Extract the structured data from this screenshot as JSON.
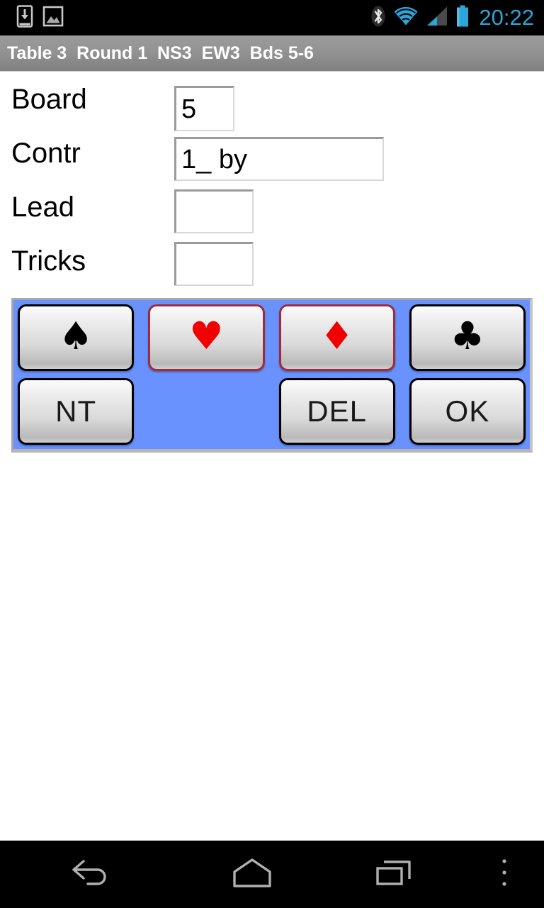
{
  "status_bar": {
    "icons_left": [
      "download-icon",
      "screenshot-image-icon"
    ],
    "icons_right": [
      "bluetooth-icon",
      "wifi-icon",
      "cellular-signal-icon",
      "battery-icon"
    ],
    "clock": "20:22",
    "clock_color": "#2ca5d8",
    "background_color": "#000000"
  },
  "title_bar": {
    "text": "Table 3  Round 1  NS3  EW3  Bds 5-6",
    "table": "Table 3",
    "round": "Round 1",
    "ns": "NS3",
    "ew": "EW3",
    "boards": "Bds 5-6",
    "background_color": "#8f8f8f",
    "text_color": "#ffffff"
  },
  "form": {
    "rows": [
      {
        "label": "Board",
        "value": "5",
        "placeholder": "",
        "name": "board"
      },
      {
        "label": "Contr",
        "value": "1_ by",
        "placeholder": "",
        "name": "contract"
      },
      {
        "label": "Lead",
        "value": "",
        "placeholder": "",
        "name": "lead"
      },
      {
        "label": "Tricks",
        "value": "",
        "placeholder": "",
        "name": "tricks"
      }
    ]
  },
  "keypad": {
    "background_color": "#6992ff",
    "keys": [
      {
        "id": "spade",
        "glyph": "♠",
        "label": "",
        "icon": "spade-suit-icon",
        "color": "#000000",
        "border": "#000000",
        "type": "suit"
      },
      {
        "id": "heart",
        "glyph": "♥",
        "label": "",
        "icon": "heart-suit-icon",
        "color": "#f00000",
        "border": "#a12b3a",
        "type": "suit"
      },
      {
        "id": "diamond",
        "glyph": "♦",
        "label": "",
        "icon": "diamond-suit-icon",
        "color": "#f00000",
        "border": "#a12b3a",
        "type": "suit"
      },
      {
        "id": "club",
        "glyph": "♣",
        "label": "",
        "icon": "club-suit-icon",
        "color": "#000000",
        "border": "#000000",
        "type": "suit"
      },
      {
        "id": "nt",
        "glyph": "",
        "label": "NT",
        "icon": "",
        "color": "#1a1a1a",
        "border": "#000000",
        "type": "text"
      },
      {
        "id": "blank",
        "glyph": "",
        "label": "",
        "icon": "",
        "color": "",
        "border": "",
        "type": "blank"
      },
      {
        "id": "del",
        "glyph": "",
        "label": "DEL",
        "icon": "",
        "color": "#1a1a1a",
        "border": "#000000",
        "type": "text"
      },
      {
        "id": "ok",
        "glyph": "",
        "label": "OK",
        "icon": "",
        "color": "#1a1a1a",
        "border": "#000000",
        "type": "text"
      }
    ]
  },
  "nav_bar": {
    "items": [
      {
        "name": "back-button",
        "icon": "back-arrow-icon"
      },
      {
        "name": "home-button",
        "icon": "home-icon"
      },
      {
        "name": "recents-button",
        "icon": "recent-apps-icon"
      },
      {
        "name": "menu-button",
        "icon": "overflow-menu-icon"
      }
    ],
    "background_color": "#000000"
  }
}
